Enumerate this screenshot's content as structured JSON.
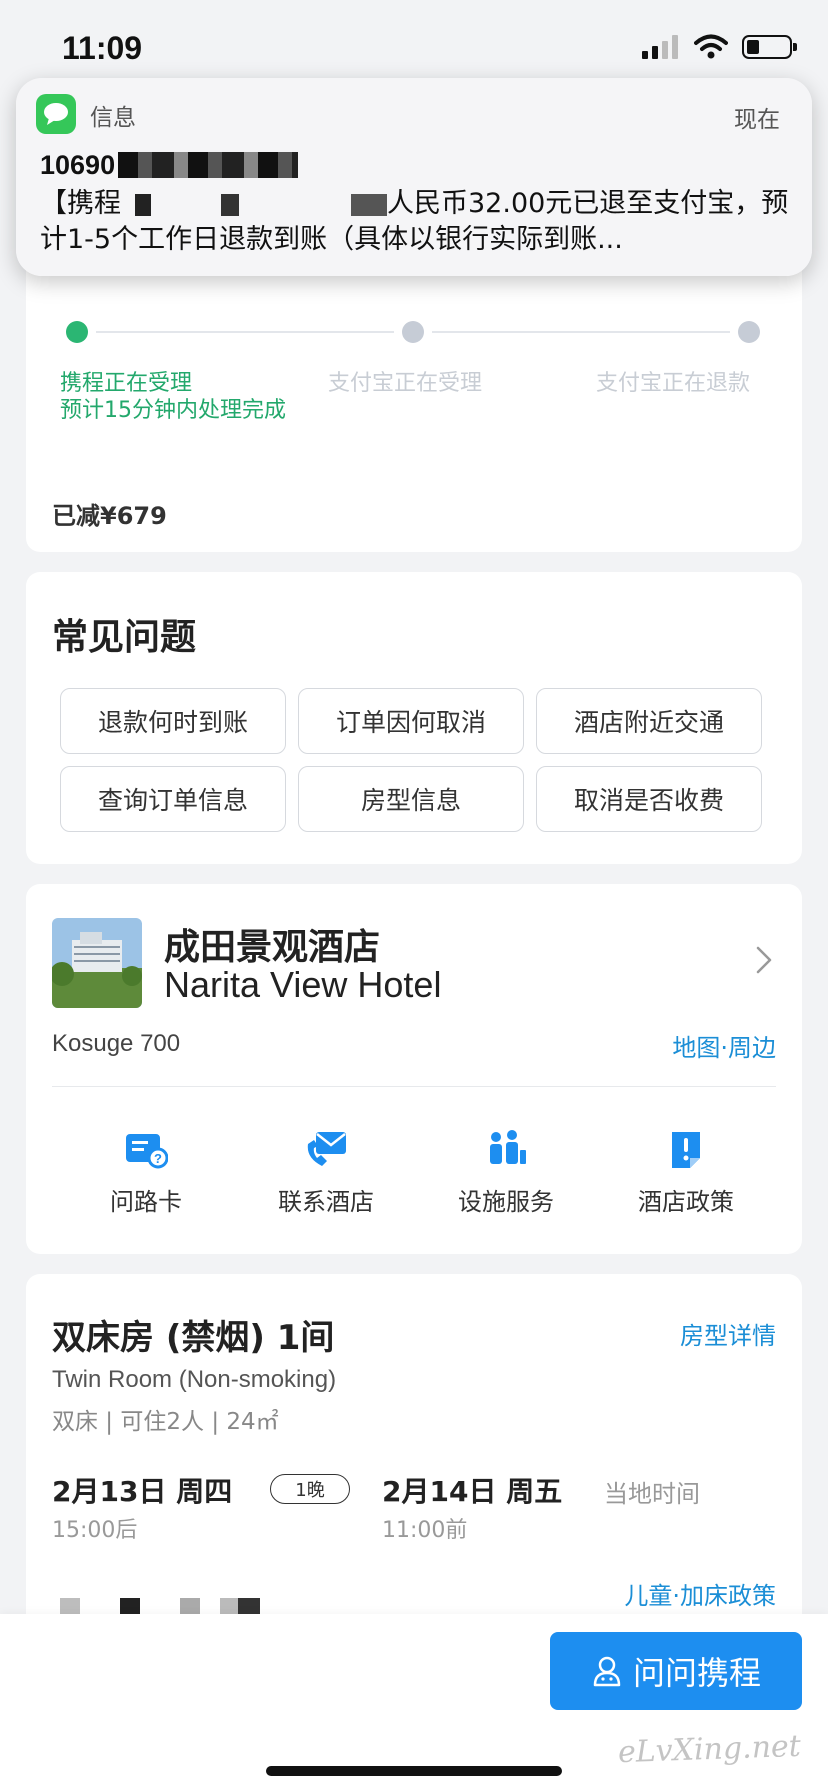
{
  "status_bar": {
    "time": "11:09"
  },
  "notification": {
    "app_name": "信息",
    "time": "现在",
    "sender": "10690",
    "body_part1": "【携程",
    "body_part2": "人民币32.00元已退至支付宝，预计1-5个工作日退款到账（具体以银行实际到账..."
  },
  "refund_progress": {
    "steps": [
      {
        "label": "携程正在受理",
        "sub": "预计15分钟内处理完成",
        "active": true
      },
      {
        "label": "支付宝正在受理",
        "sub": "",
        "active": false
      },
      {
        "label": "支付宝正在退款",
        "sub": "",
        "active": false
      }
    ],
    "discount": "已减¥679"
  },
  "faq": {
    "title": "常见问题",
    "buttons": [
      "退款何时到账",
      "订单因何取消",
      "酒店附近交通",
      "查询订单信息",
      "房型信息",
      "取消是否收费"
    ]
  },
  "hotel": {
    "name_cn": "成田景观酒店",
    "name_en": "Narita View Hotel",
    "address": "Kosuge 700",
    "map_link": "地图·周边",
    "actions": [
      {
        "label": "问路卡",
        "icon": "direction-card-icon"
      },
      {
        "label": "联系酒店",
        "icon": "phone-mail-icon"
      },
      {
        "label": "设施服务",
        "icon": "people-service-icon"
      },
      {
        "label": "酒店政策",
        "icon": "policy-icon"
      }
    ]
  },
  "room": {
    "title": "双床房 (禁烟) 1间",
    "detail_link": "房型详情",
    "name_en": "Twin Room (Non-smoking)",
    "info": "双床 | 可住2人 | 24㎡",
    "checkin_date": "2月13日 周四",
    "checkin_time": "15:00后",
    "nights": "1晚",
    "checkout_date": "2月14日 周五",
    "checkout_time": "11:00前",
    "local_time": "当地时间",
    "policy_link": "儿童·加床政策"
  },
  "bottom": {
    "ask_button": "问问携程",
    "watermark": "eLvXing.net"
  },
  "colors": {
    "accent_blue": "#1d8ef0",
    "active_green": "#2bb673",
    "link_blue": "#1b8ed6"
  }
}
